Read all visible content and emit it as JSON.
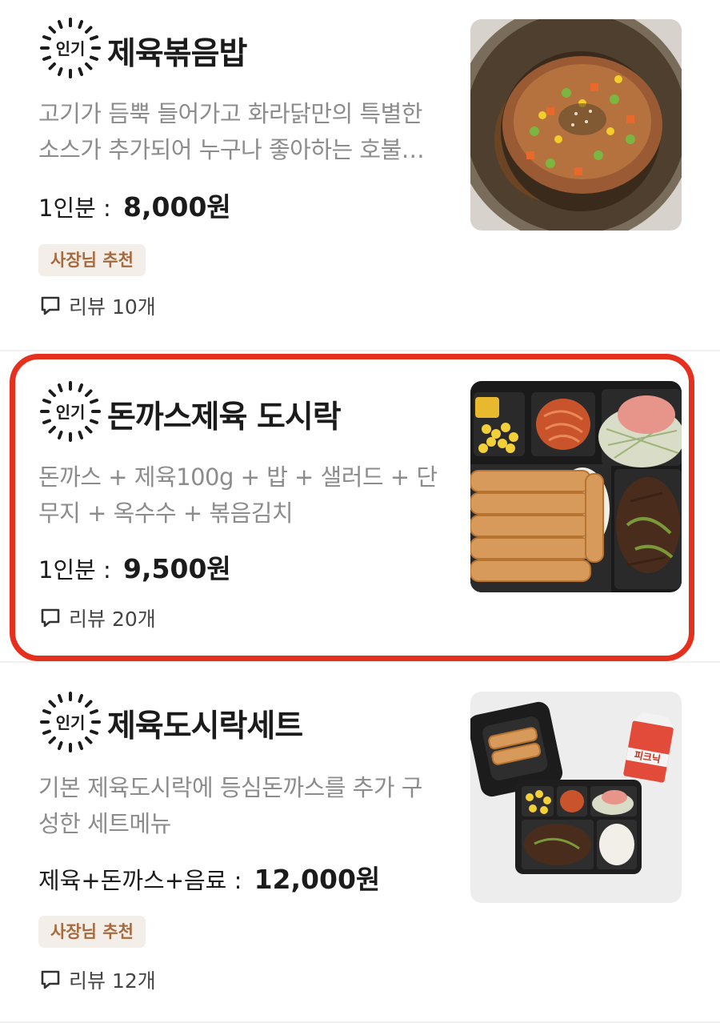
{
  "items": [
    {
      "badge": "인기",
      "title": "제육볶음밥",
      "desc_lines": [
        "고기가 듬뿍 들어가고 화라닭만의 특별한",
        "소스가 추가되어 누구나 좋아하는 호불…"
      ],
      "unit": "1인분",
      "separator": ":",
      "price": "8,000원",
      "tag": "사장님 추천",
      "review": "리뷰 10개",
      "image_icon": "fried-rice-photo"
    },
    {
      "badge": "인기",
      "title": "돈까스제육 도시락",
      "desc_lines": [
        "돈까스 + 제육100g + 밥 + 샐러드 + 단",
        "무지 + 옥수수 + 볶음김치"
      ],
      "unit": "1인분",
      "separator": ":",
      "price": "9,500원",
      "review": "리뷰 20개",
      "image_icon": "lunchbox-photo"
    },
    {
      "badge": "인기",
      "title": "제육도시락세트",
      "desc_lines": [
        "기본 제육도시락에 등심돈까스를 추가 구",
        "성한 세트메뉴"
      ],
      "unit": "제육+돈까스+음료",
      "separator": ":",
      "price": "12,000원",
      "tag": "사장님 추천",
      "review": "리뷰 12개",
      "drink_label": "피크닉",
      "image_icon": "lunchbox-set-photo"
    }
  ],
  "colors": {
    "highlight_border": "#e5301d",
    "tag_bg": "#f4eee9",
    "tag_text": "#a66a3e",
    "desc_text": "#8c8c8c"
  }
}
